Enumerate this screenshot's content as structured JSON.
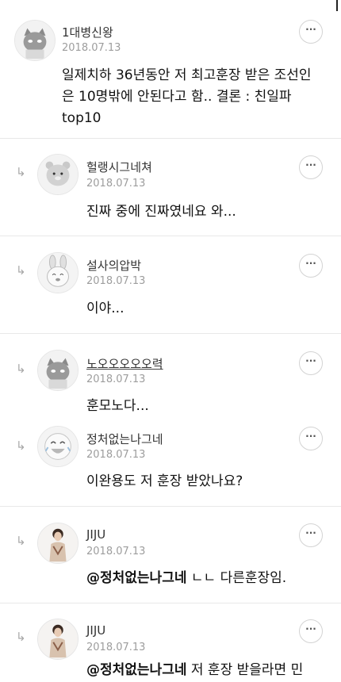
{
  "comments": [
    {
      "nickname": "1대병신왕",
      "date": "2018.07.13",
      "text": "일제치하 36년동안 저 최고훈장 받은 조선인은 10명밖에 안된다고 함.. 결론 : 친일파 top10",
      "avatar_icon": "gray-cat-avatar-icon",
      "more_label": "···"
    },
    {
      "nickname": "헐랭시그네쳐",
      "date": "2018.07.13",
      "text": "진짜 중에 진짜였네요 와...",
      "avatar_icon": "bear-avatar-icon",
      "more_label": "···"
    },
    {
      "nickname": "설사의압박",
      "date": "2018.07.13",
      "text": "이야...",
      "avatar_icon": "rabbit-avatar-icon",
      "more_label": "···"
    },
    {
      "nickname": "노오오오오오력",
      "date": "2018.07.13",
      "text": "훈모노다...",
      "avatar_icon": "gray-cat-avatar-icon",
      "more_label": "···"
    },
    {
      "nickname": "정처없는나그네",
      "date": "2018.07.13",
      "text": "이완용도 저 훈장 받았나요?",
      "avatar_icon": "laughing-face-avatar-icon",
      "more_label": "···"
    },
    {
      "nickname": "JIJU",
      "date": "2018.07.13",
      "mention": "@정처없는나그네",
      "text": "ㄴㄴ 다른훈장임.",
      "avatar_icon": "person-avatar-icon",
      "more_label": "···"
    },
    {
      "nickname": "JIJU",
      "date": "2018.07.13",
      "mention": "@정처없는나그네",
      "text": "저 훈장 받을라면 민",
      "avatar_icon": "person-avatar-icon",
      "more_label": "···"
    }
  ],
  "icons": {
    "reply": "reply-arrow-icon",
    "more": "more-options-icon"
  },
  "colors": {
    "divider": "#e8e8e8",
    "date": "#9d9d9d",
    "more_border": "#d3d3d3"
  }
}
